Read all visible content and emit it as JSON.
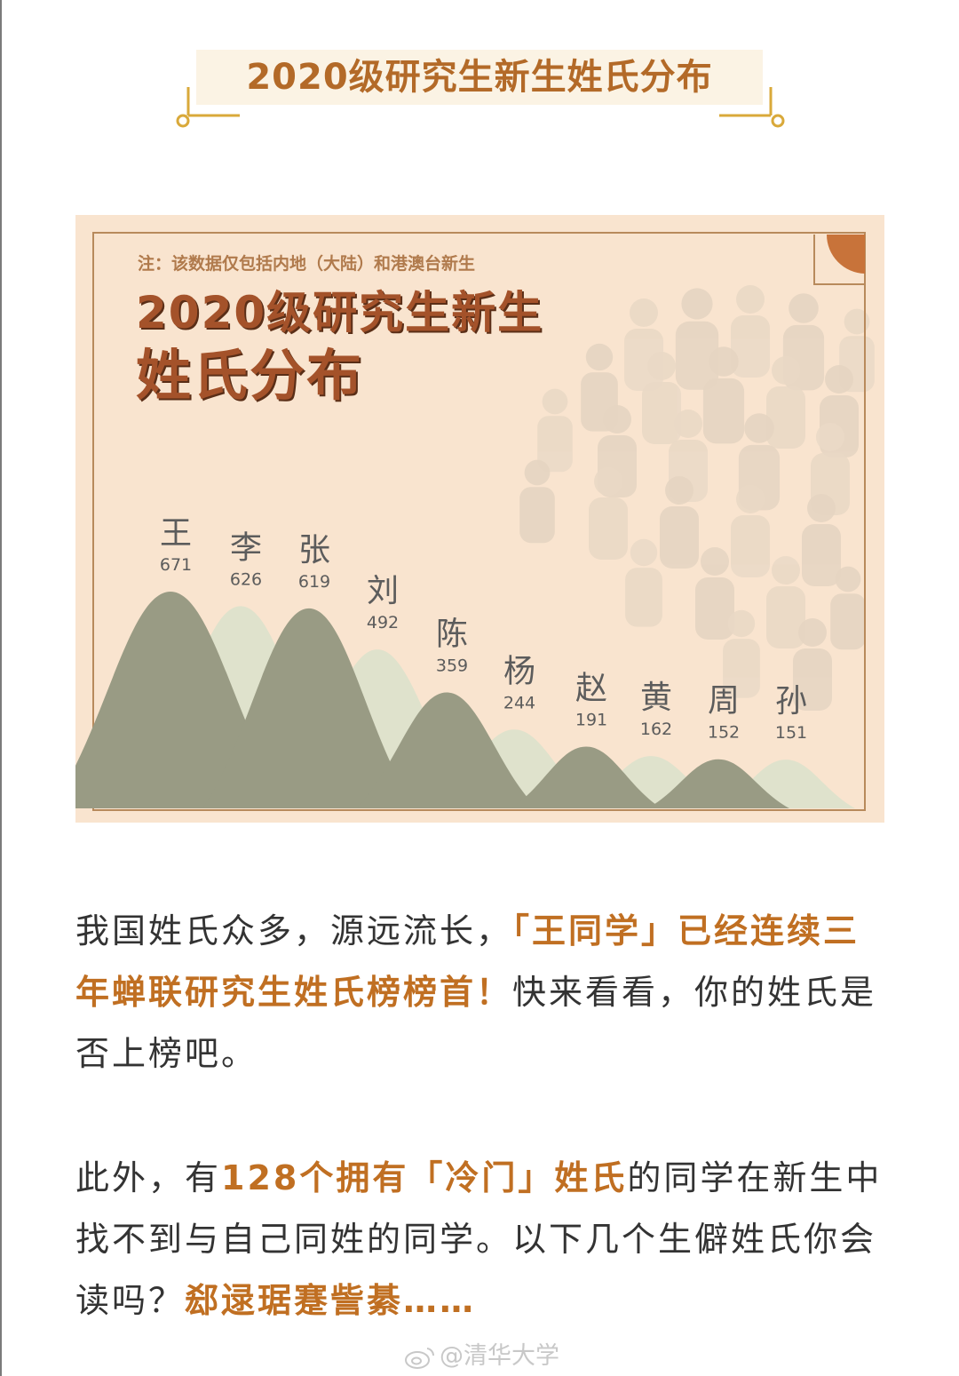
{
  "header": {
    "title": "2020级研究生新生姓氏分布"
  },
  "card": {
    "note": "注：该数据仅包括内地（大陆）和港澳台新生",
    "title_line1": "2020级研究生新生",
    "title_line2": "姓氏分布"
  },
  "chart_data": {
    "type": "area",
    "categories": [
      "王",
      "李",
      "张",
      "刘",
      "陈",
      "杨",
      "赵",
      "黄",
      "周",
      "孙"
    ],
    "values": [
      671,
      626,
      619,
      492,
      359,
      244,
      191,
      162,
      152,
      151
    ],
    "colors": {
      "dark": "#999b84",
      "light": "#dce2cc",
      "label": "#5c5c5c"
    }
  },
  "paragraph1": {
    "t1": "我国姓氏众多，源远流长，",
    "h1": "「王同学」已经连续三年蝉联研究生姓氏榜榜首！",
    "t2": "快来看看，你的姓氏是否上榜吧。"
  },
  "paragraph2": {
    "t1": "此外，有",
    "h1": "128个拥有「冷门」姓氏",
    "t2": "的同学在新生中找不到与自己同姓的同学。以下几个生僻姓氏你会读吗？",
    "h2": "郄逯琚蹇訾綦……"
  },
  "watermark": {
    "text": "@清华大学",
    "icon": "weibo-icon"
  },
  "colors": {
    "accent": "#c06f22",
    "title": "#b36a28",
    "card_bg": "#f9e4cf"
  }
}
